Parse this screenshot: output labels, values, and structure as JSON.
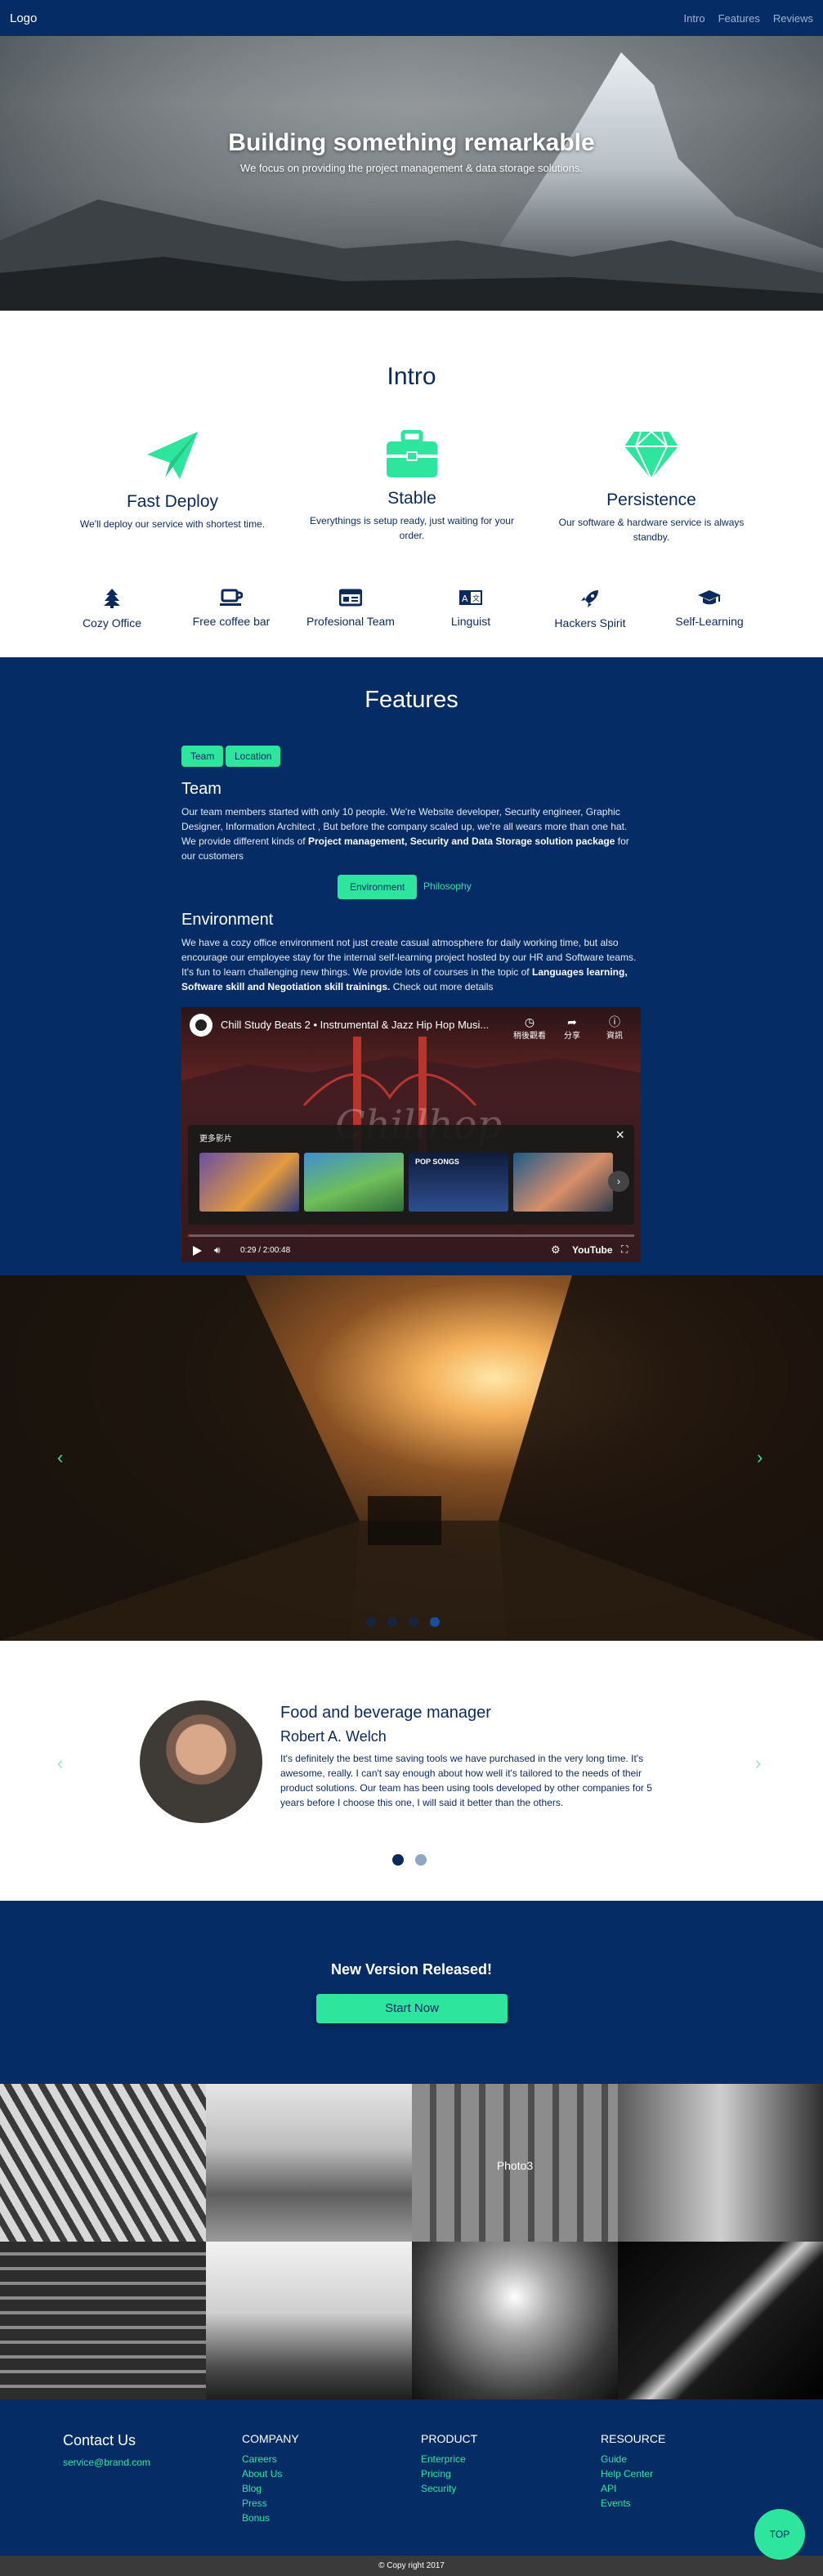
{
  "navbar": {
    "logo": "Logo",
    "links": [
      "Intro",
      "Features",
      "Reviews"
    ]
  },
  "hero": {
    "title": "Building something remarkable",
    "subtitle": "We focus on providing the project management & data storage solutions."
  },
  "intro": {
    "title": "Intro",
    "features": [
      {
        "icon": "paper-plane-icon",
        "title": "Fast Deploy",
        "text": "We'll deploy our service with shortest time."
      },
      {
        "icon": "briefcase-icon",
        "title": "Stable",
        "text": "Everythings is setup ready, just waiting for your order."
      },
      {
        "icon": "diamond-icon",
        "title": "Persistence",
        "text": "Our software & hardware service is always standby."
      }
    ],
    "perks": [
      {
        "icon": "tree-icon",
        "label": "Cozy Office"
      },
      {
        "icon": "coffee-icon",
        "label": "Free coffee bar"
      },
      {
        "icon": "id-card-icon",
        "label": "Profesional Team"
      },
      {
        "icon": "language-icon",
        "label": "Linguist"
      },
      {
        "icon": "rocket-icon",
        "label": "Hackers Spirit"
      },
      {
        "icon": "graduation-cap-icon",
        "label": "Self-Learning"
      }
    ]
  },
  "features": {
    "title": "Features",
    "tabs1": [
      "Team",
      "Location"
    ],
    "team_title": "Team",
    "team_text_1": "Our team members started with only 10 people. We're Website developer, Security engineer, Graphic Designer, Information Architect , But before the company scaled up, we're all wears more than one hat. We provide different kinds of ",
    "team_text_bold": "Project management, Security and Data Storage solution package",
    "team_text_2": " for our customers",
    "tabs2": [
      "Environment",
      "Philosophy"
    ],
    "env_title": "Environment",
    "env_text_1": "We have a cozy office environment not just create casual atmosphere for daily working time, but also encourage our employee stay for the internal self-learning project hosted by our HR and Software teams. It's fun to learn challenging new things. We provide lots of courses in the topic of ",
    "env_text_bold": "Languages learning, Software skill and Negotiation skill trainings.",
    "env_text_2": " Check out more details",
    "video": {
      "title": "Chill Study Beats 2 • Instrumental & Jazz Hip Hop Musi...",
      "actions": [
        "稍後觀看",
        "分享",
        "資訊"
      ],
      "more_label": "更多影片",
      "thumb_text": "POP SONGS",
      "time": "0:29 / 2:00:48",
      "brand": "YouTube",
      "progress": 0.004
    }
  },
  "carousel": {
    "dots": 4,
    "active": 3
  },
  "testimonial": {
    "job": "Food and beverage manager",
    "name": "Robert A. Welch",
    "text": "It's definitely the best time saving tools we have purchased in the very long time. It's awesome, really. I can't say enough about how well it's tailored to the needs of their product solutions. Our team has been using tools developed by other companies for 5 years before I choose this one, I will said it better than the others.",
    "dots": 2,
    "active": 0
  },
  "release": {
    "title": "New Version Released!",
    "button": "Start Now"
  },
  "gallery": {
    "label": "Photo3"
  },
  "footer": {
    "contact_title": "Contact Us",
    "email": "service@brand.com",
    "columns": [
      {
        "title": "COMPANY",
        "links": [
          "Careers",
          "About Us",
          "Blog",
          "Press",
          "Bonus"
        ]
      },
      {
        "title": "PRODUCT",
        "links": [
          "Enterprice",
          "Pricing",
          "Security"
        ]
      },
      {
        "title": "RESOURCE",
        "links": [
          "Guide",
          "Help Center",
          "API",
          "Events"
        ]
      }
    ],
    "top_button": "TOP",
    "copyright": "© Copy right 2017"
  },
  "colors": {
    "navy": "#052c65",
    "accent": "#2ee59d",
    "text": "#0b2a5c"
  }
}
